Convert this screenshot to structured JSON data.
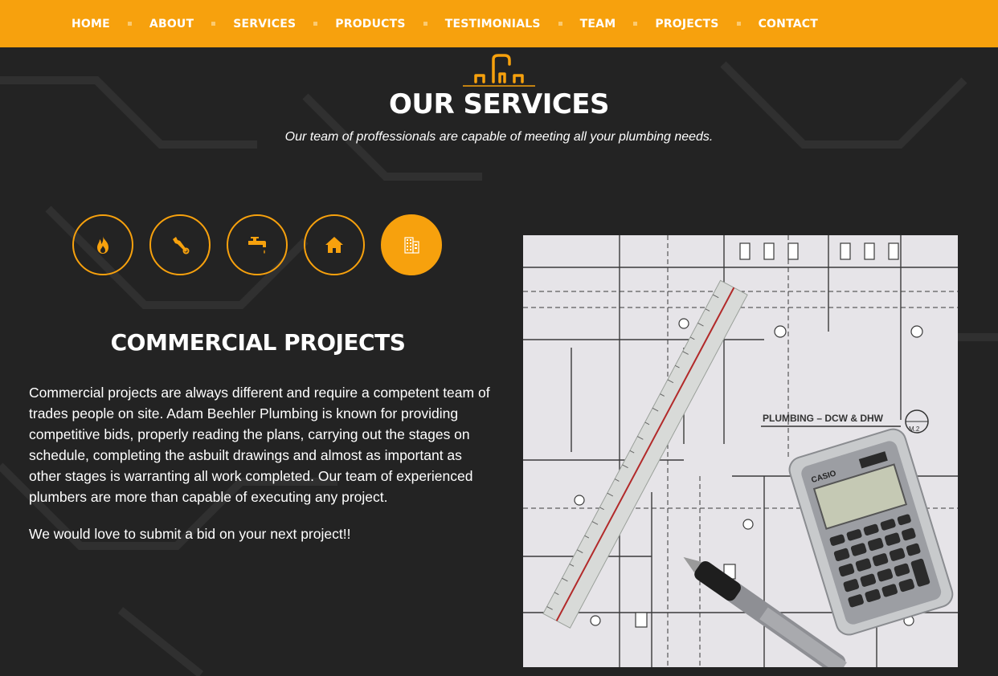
{
  "nav": {
    "items": [
      {
        "label": "HOME"
      },
      {
        "label": "ABOUT"
      },
      {
        "label": "SERVICES"
      },
      {
        "label": "PRODUCTS"
      },
      {
        "label": "TESTIMONIALS"
      },
      {
        "label": "TEAM"
      },
      {
        "label": "PROJECTS"
      },
      {
        "label": "CONTACT"
      }
    ]
  },
  "header": {
    "logo_icon": "faucet-icon",
    "title": "OUR SERVICES",
    "subtitle": "Our team of proffessionals are capable of meeting all your plumbing needs."
  },
  "tabs": [
    {
      "icon": "flame-icon",
      "active": false
    },
    {
      "icon": "wrench-icon",
      "active": false
    },
    {
      "icon": "faucet-icon",
      "active": false
    },
    {
      "icon": "house-icon",
      "active": false
    },
    {
      "icon": "building-icon",
      "active": true
    }
  ],
  "content": {
    "title": "COMMERCIAL PROJECTS",
    "paragraphs": [
      "Commercial projects are always different and require a competent team of trades people on site. Adam Beehler Plumbing is known for providing competitive bids, properly reading the plans, carrying out the stages on schedule, completing the asbuilt drawings and almost as important as other stages is warranting all work completed. Our team of experienced plumbers are more than capable of executing any project.",
      "We would love to submit a bid on your next project!!"
    ]
  },
  "photo": {
    "drawing_title": "PLUMBING – DCW & DHW",
    "drawing_ref": "M.2",
    "calculator_brand": "CASIO"
  },
  "colors": {
    "accent": "#f7a10d",
    "background": "#232323",
    "text": "#ffffff"
  }
}
